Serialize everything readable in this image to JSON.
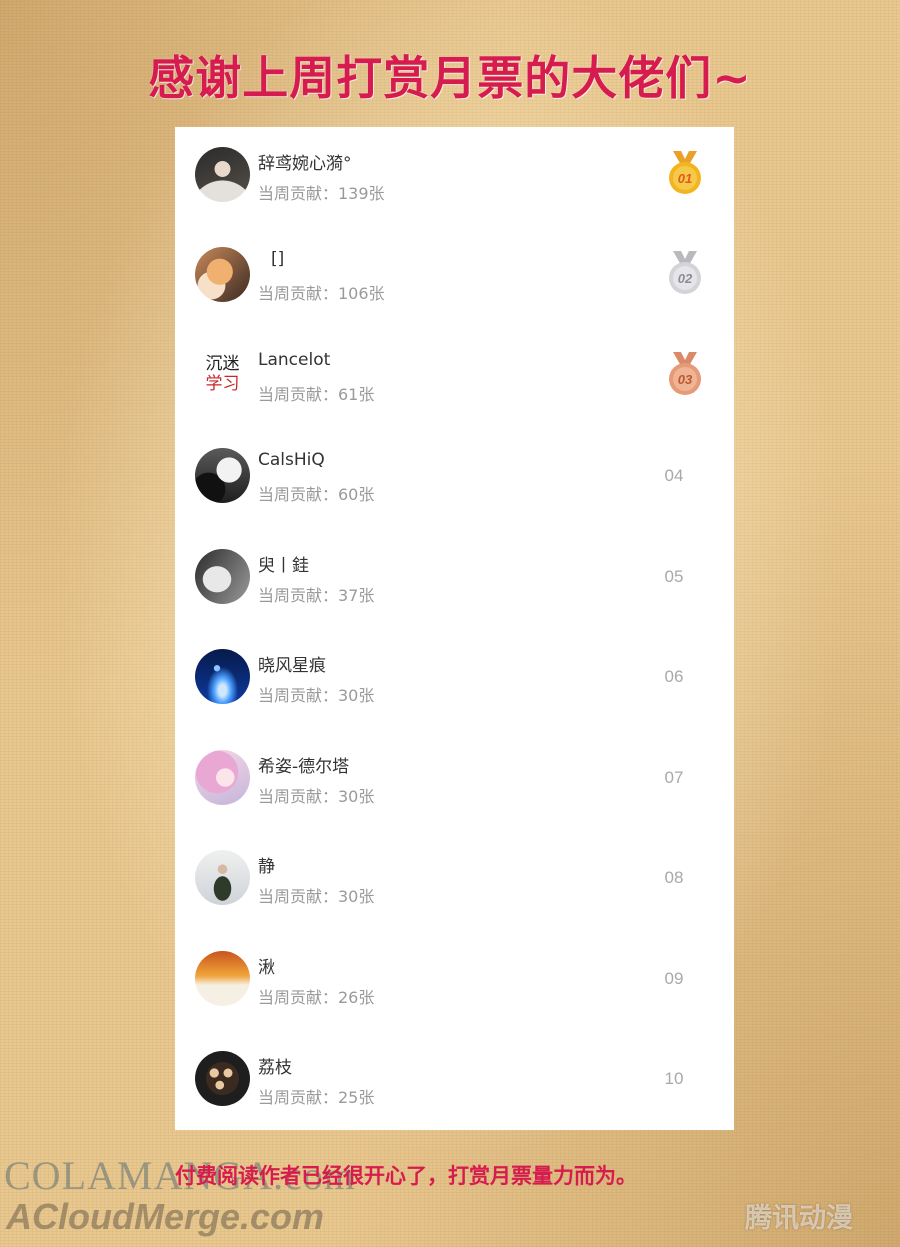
{
  "title": "感谢上周打赏月票的大佬们~",
  "contribution_prefix": "当周贡献：",
  "contributors": [
    {
      "rank": "01",
      "name": "辞鸢婉心漪°",
      "contribution": "当周贡献：139张",
      "medal": "gold",
      "avatar": "dark-photo"
    },
    {
      "rank": "02",
      "name": "[]",
      "contribution": "当周贡献：106张",
      "medal": "silver",
      "avatar": "cat-photo"
    },
    {
      "rank": "03",
      "name": "Lancelot",
      "contribution": "当周贡献：61张",
      "medal": "bronze",
      "avatar": "text-image",
      "avatar_text": [
        "沉迷",
        "学习"
      ]
    },
    {
      "rank": "04",
      "name": "CalsHiQ",
      "contribution": "当周贡献：60张",
      "medal": "",
      "avatar": "moon-photo"
    },
    {
      "rank": "05",
      "name": "臾丨銈",
      "contribution": "当周贡献：37张",
      "medal": "",
      "avatar": "face-photo"
    },
    {
      "rank": "06",
      "name": "晓风星痕",
      "contribution": "当周贡献：30张",
      "medal": "",
      "avatar": "space-photo"
    },
    {
      "rank": "07",
      "name": "希姿-德尔塔",
      "contribution": "当周贡献：30张",
      "medal": "",
      "avatar": "anime-photo"
    },
    {
      "rank": "08",
      "name": "静",
      "contribution": "当周贡献：30张",
      "medal": "",
      "avatar": "snow-photo"
    },
    {
      "rank": "09",
      "name": "湫",
      "contribution": "当周贡献：26张",
      "medal": "",
      "avatar": "sunset-photo"
    },
    {
      "rank": "10",
      "name": "荔枝",
      "contribution": "当周贡献：25张",
      "medal": "",
      "avatar": "food-photo"
    }
  ],
  "footer": "付费阅读作者已经很开心了，打赏月票量力而为。",
  "watermarks": {
    "colamanga": "COLAMANGA.com",
    "acloudmerge": "ACloudMerge.com",
    "logo": "腾讯动漫"
  },
  "colors": {
    "accent": "#d61c4e",
    "gold": "#f3b51f",
    "silver": "#c8c8cc",
    "bronze": "#e59a78"
  }
}
